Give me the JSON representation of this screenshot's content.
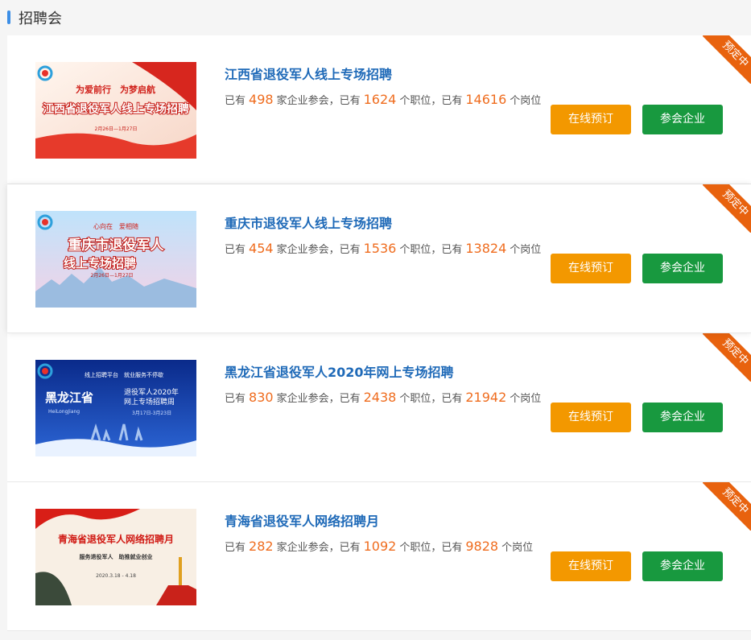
{
  "section": {
    "title": "招聘会"
  },
  "labels": {
    "has": "已有",
    "enterprise_suffix": "家企业参会，",
    "has2": "已有",
    "position_suffix": "个职位，",
    "has3": "已有",
    "post_suffix": "个岗位",
    "reserve": "在线预订",
    "company": "参会企业",
    "ribbon": "预定中"
  },
  "fairs": [
    {
      "name": "江西省退役军人线上专场招聘",
      "enterprises": "498",
      "positions": "1624",
      "posts": "14616",
      "poster": {
        "slogan": "为爱前行　为梦启航",
        "headline": "江西省退役军人线上专场招聘",
        "date": "2月26日—1月27日",
        "theme": "red"
      }
    },
    {
      "name": "重庆市退役军人线上专场招聘",
      "enterprises": "454",
      "positions": "1536",
      "posts": "13824",
      "poster": {
        "slogan": "心向在　爱相随",
        "headline": "重庆市退役军人",
        "headline2": "线上专场招聘",
        "date": "2月26日—1月27日",
        "theme": "sky"
      }
    },
    {
      "name": "黑龙江省退役军人2020年网上专场招聘",
      "enterprises": "830",
      "positions": "2438",
      "posts": "21942",
      "poster": {
        "slogan": "线上招聘平台　就业服务不停歇",
        "headline": "黑龙江省",
        "pinyin": "HeiLongJiang",
        "sub": "退役军人2020年",
        "sub2": "网上专场招聘周",
        "date": "3月17日-3月23日",
        "theme": "blue"
      }
    },
    {
      "name": "青海省退役军人网络招聘月",
      "enterprises": "282",
      "positions": "1092",
      "posts": "9828",
      "poster": {
        "headline": "青海省退役军人网络招聘月",
        "sub": "服务退役军人　助推就业创业",
        "date": "2020.3.18 - 4.18",
        "theme": "flag"
      }
    }
  ]
}
